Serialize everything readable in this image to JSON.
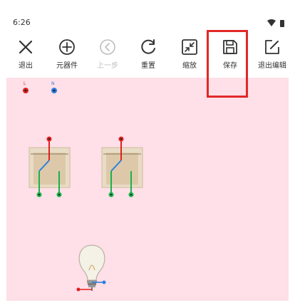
{
  "status_bar": {
    "time": "6:26"
  },
  "toolbar": {
    "items": [
      {
        "label": "退出",
        "icon": "close-icon",
        "enabled": true
      },
      {
        "label": "元器件",
        "icon": "plus-circle-icon",
        "enabled": true
      },
      {
        "label": "上一步",
        "icon": "back-circle-icon",
        "enabled": false
      },
      {
        "label": "重置",
        "icon": "reset-icon",
        "enabled": true
      },
      {
        "label": "缩放",
        "icon": "shrink-icon",
        "enabled": true
      },
      {
        "label": "保存",
        "icon": "save-icon",
        "enabled": true
      },
      {
        "label": "退出编辑",
        "icon": "edit-icon",
        "enabled": true
      }
    ]
  },
  "canvas": {
    "terminals": [
      {
        "label": "L",
        "color": "#e02020"
      },
      {
        "label": "N",
        "color": "#2a7fe0"
      }
    ],
    "components": [
      "switch",
      "switch",
      "bulb"
    ],
    "colors": {
      "background": "#ffdfe8",
      "live": "#e02020",
      "neutral": "#2a7fe0",
      "switch_out": "#17b34a",
      "highlight": "#e12828"
    }
  }
}
